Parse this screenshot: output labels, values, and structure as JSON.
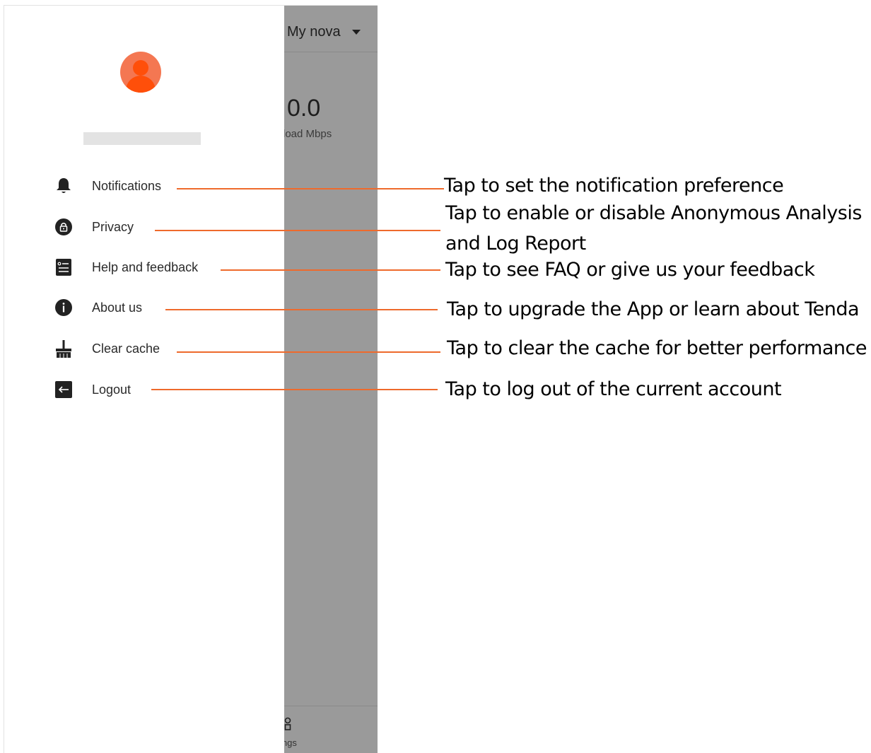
{
  "app": {
    "network_name": "My nova",
    "speed_value": "0.0",
    "speed_label": "load Mbps",
    "tab_label": "ings"
  },
  "drawer": {
    "avatar_color": "#f47752",
    "items": [
      {
        "label": "Notifications",
        "icon": "bell-icon"
      },
      {
        "label": "Privacy",
        "icon": "lock-icon"
      },
      {
        "label": "Help and feedback",
        "icon": "document-icon"
      },
      {
        "label": "About us",
        "icon": "info-icon"
      },
      {
        "label": "Clear cache",
        "icon": "broom-icon"
      },
      {
        "label": "Logout",
        "icon": "logout-icon"
      }
    ]
  },
  "annotations": [
    "Tap to set the notification preference",
    "Tap to enable or disable Anonymous Analysis",
    "and Log Report",
    "Tap to see FAQ or give us your feedback",
    "Tap to upgrade the App or learn about Tenda",
    "Tap to clear the cache for better performance",
    "Tap to log out of the current account"
  ],
  "colors": {
    "accent": "#ee6a2c",
    "overlay": "#9a9a9a"
  }
}
